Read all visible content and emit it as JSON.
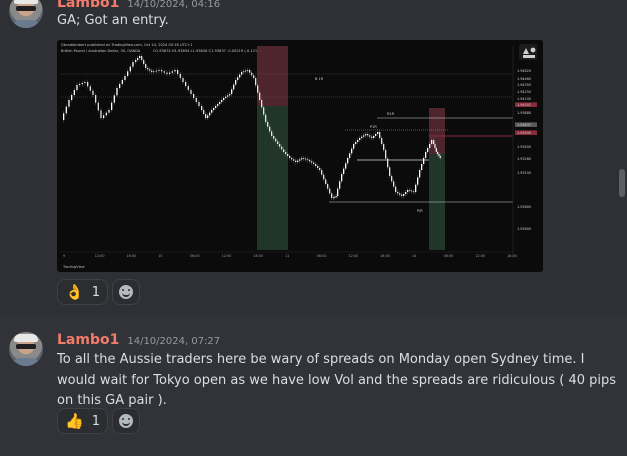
{
  "messages": [
    {
      "username": "Lambo1",
      "timestamp": "14/10/2024, 04:16",
      "text": "GA; Got an entry.",
      "reactions": [
        {
          "emoji": "👌",
          "count": "1"
        }
      ]
    },
    {
      "username": "Lambo1",
      "timestamp": "14/10/2024, 07:27",
      "text": "To all the Aussie traders here be wary of spreads on Monday open Sydney time. I would wait for Tokyo open as we have low Vol and the spreads are ridiculous ( 40 pips on this GA pair ).",
      "reactions": [
        {
          "emoji": "👍",
          "count": "1"
        }
      ]
    }
  ],
  "chart_embed": {
    "publisher_line": "Gbradlambert published on TradingView.com, Oct 14, 2024 05:16 UTC+1",
    "symbol_line": "British Pound / Australian Dollar, 30, OANDA",
    "ohlc_line": "O1.93874 H1.93894 L1.93626 C1.93637 -0.00219 (-0.11%)",
    "watermark": "TradingView",
    "x_ticks": [
      "9",
      "12:00",
      "18:00",
      "10",
      "06:00",
      "12:00",
      "18:00",
      "11",
      "06:00",
      "12:00",
      "18:00",
      "14",
      "06:00",
      "12:00",
      "18:00"
    ],
    "price_labels": [
      "1.94620",
      "1.94460",
      "1.94355",
      "1.94250",
      "1.94100",
      "1.94002",
      "1.93880",
      "1.93637",
      "1.93490",
      "1.93400",
      "1.93280",
      "1.93150",
      "1.92800",
      "1.92600"
    ],
    "annotations": [
      "B 1R",
      "R1R",
      "P1R",
      "P/R"
    ],
    "accent_up": "#e5e5e5",
    "accent_down": "#ffffff",
    "zone_red": "#5a2a33",
    "zone_green": "#233a2c"
  }
}
